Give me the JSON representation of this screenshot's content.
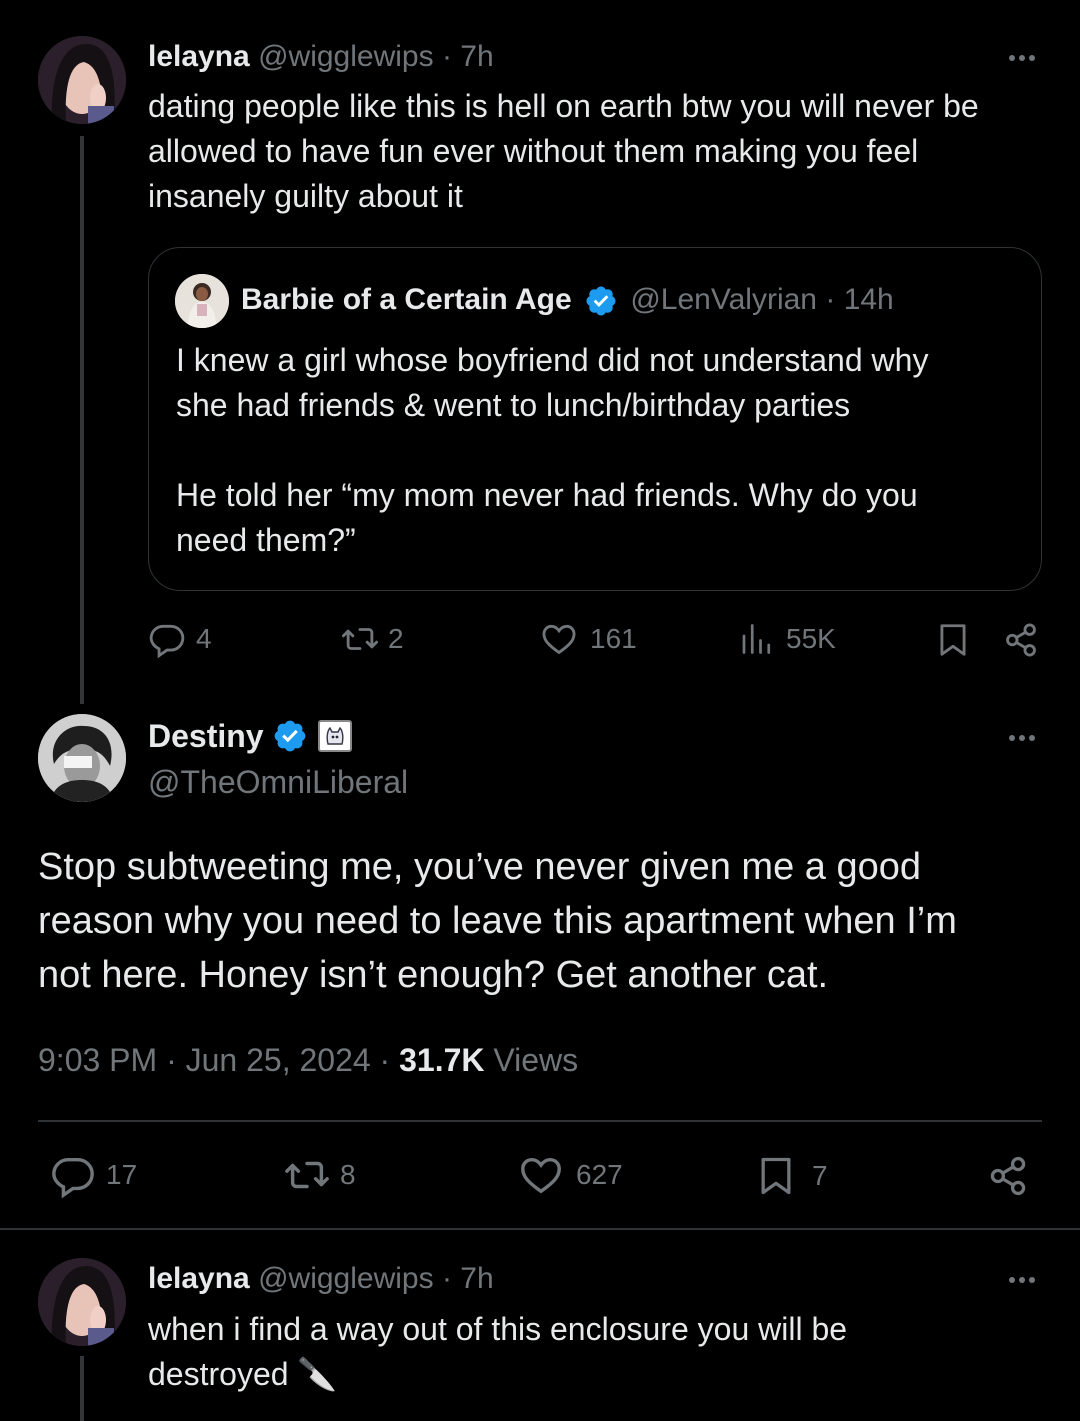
{
  "tweet1": {
    "display_name": "lelayna",
    "handle": "@wigglewips",
    "separator": "·",
    "time": "7h",
    "text_lines": [
      "dating people like this is hell on earth btw you will never be",
      "allowed to have fun ever without them making you feel",
      "insanely guilty about it"
    ],
    "quote": {
      "display_name": "Barbie of a Certain Age",
      "handle": "@LenValyrian",
      "separator": "·",
      "time": "14h",
      "text_lines": [
        "I knew a girl whose boyfriend did not understand why",
        "she had friends & went to lunch/birthday parties",
        "",
        "He told her “my mom never had friends. Why do you",
        "need them?”"
      ]
    },
    "actions": {
      "replies": "4",
      "reposts": "2",
      "likes": "161",
      "views": "55K"
    }
  },
  "main_tweet": {
    "display_name": "Destiny",
    "handle": "@TheOmniLiberal",
    "text_lines": [
      "Stop subtweeting me, you’ve never given me a good",
      "reason why you need to leave this apartment when I’m",
      "not here. Honey isn’t enough? Get another cat."
    ],
    "timestamp": "9:03 PM · Jun 25, 2024 · ",
    "views_count": "31.7K",
    "views_label": "Views",
    "actions": {
      "replies": "17",
      "reposts": "8",
      "likes": "627",
      "bookmarks": "7"
    }
  },
  "tweet3": {
    "display_name": "lelayna",
    "handle": "@wigglewips",
    "separator": "·",
    "time": "7h",
    "text_lines": [
      "when i find a way out of this enclosure you will be",
      "destroyed"
    ],
    "emoji": "🔪"
  },
  "colors": {
    "background": "#000000",
    "text": "#e7e9ea",
    "muted": "#71767b",
    "border": "#2f3336",
    "verified": "#1d9bf0"
  }
}
